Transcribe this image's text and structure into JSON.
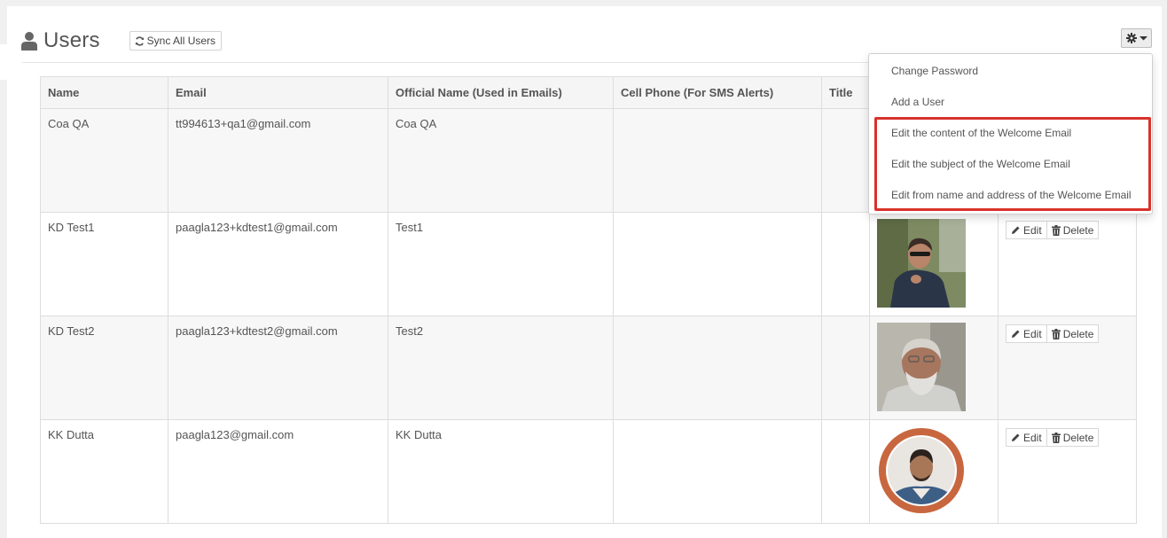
{
  "header": {
    "title": "Users",
    "sync_label": "Sync All Users"
  },
  "table": {
    "columns": [
      "Name",
      "Email",
      "Official Name (Used in Emails)",
      "Cell Phone (For SMS Alerts)",
      "Title",
      "",
      ""
    ],
    "rows": [
      {
        "name": "Coa QA",
        "email": "tt994613+qa1@gmail.com",
        "official_name": "Coa QA",
        "cell": "",
        "title": "",
        "photo": ""
      },
      {
        "name": "KD Test1",
        "email": "paagla123+kdtest1@gmail.com",
        "official_name": "Test1",
        "cell": "",
        "title": "",
        "photo": "photo-man-sunglasses"
      },
      {
        "name": "KD Test2",
        "email": "paagla123+kdtest2@gmail.com",
        "official_name": "Test2",
        "cell": "",
        "title": "",
        "photo": "photo-man-grey-beard"
      },
      {
        "name": "KK Dutta",
        "email": "paagla123@gmail.com",
        "official_name": "KK Dutta",
        "cell": "",
        "title": "",
        "photo": "photo-man-circle-frame"
      }
    ],
    "edit_label": "Edit",
    "delete_label": "Delete"
  },
  "dropdown": {
    "items": [
      "Change Password",
      "Add a User",
      "Edit the content of the Welcome Email",
      "Edit the subject of the Welcome Email",
      "Edit from name and address of the Welcome Email"
    ]
  },
  "icons": {
    "title": "user-icon",
    "sync": "refresh-icon",
    "settings": "gear-icon",
    "edit": "pencil-icon",
    "delete": "trash-icon"
  },
  "colors": {
    "highlight_border": "#d9312b",
    "photo_ring": "#c8673f"
  }
}
